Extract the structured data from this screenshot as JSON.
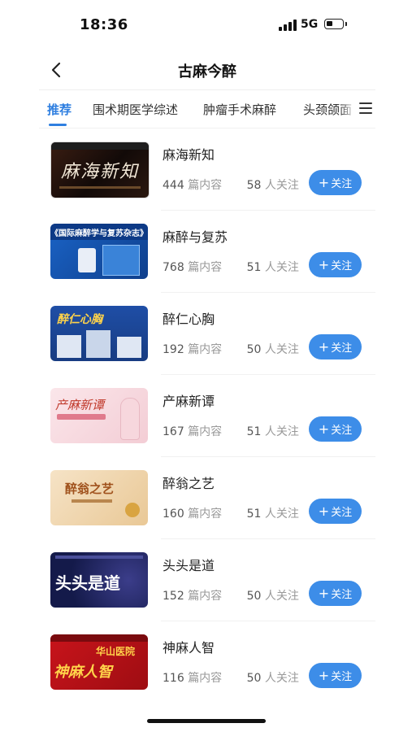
{
  "status_bar": {
    "time": "18:36",
    "network": "5G",
    "battery_icon": "battery-low-icon",
    "signal_icon": "signal-bars-icon"
  },
  "header": {
    "title": "古麻今醉",
    "back_icon": "chevron-left-icon"
  },
  "tabs": [
    {
      "label": "推荐",
      "active": true
    },
    {
      "label": "围术期医学综述",
      "active": false
    },
    {
      "label": "肿瘤手术麻醉",
      "active": false
    },
    {
      "label": "头颈颌面",
      "active": false
    }
  ],
  "tabs_menu_icon": "hamburger-menu-icon",
  "accent_color": "#2f7fe0",
  "follow_button_color": "#3d8de8",
  "units": {
    "content": "篇内容",
    "followers": "人关注"
  },
  "follow_label": "关注",
  "channels": [
    {
      "name": "麻海新知",
      "posts": "444",
      "followers": "58",
      "thumb_text": "麻海新知"
    },
    {
      "name": "麻醉与复苏",
      "posts": "768",
      "followers": "51",
      "thumb_text": "《国际麻醉学与复苏杂志》"
    },
    {
      "name": "醉仁心胸",
      "posts": "192",
      "followers": "50",
      "thumb_text": "醉仁心胸"
    },
    {
      "name": "产麻新谭",
      "posts": "167",
      "followers": "51",
      "thumb_text": "产麻新谭"
    },
    {
      "name": "醉翁之艺",
      "posts": "160",
      "followers": "51",
      "thumb_text": "醉翁之艺"
    },
    {
      "name": "头头是道",
      "posts": "152",
      "followers": "50",
      "thumb_text": "头头是道"
    },
    {
      "name": "神麻人智",
      "posts": "116",
      "followers": "50",
      "thumb_text": "神麻人智",
      "thumb_subtext": "华山医院"
    }
  ]
}
